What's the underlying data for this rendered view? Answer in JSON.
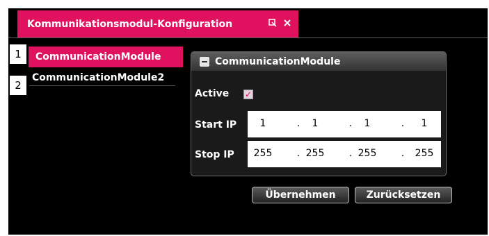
{
  "tab": {
    "title": "Kommunikationsmodul-Konfiguration"
  },
  "modules": [
    {
      "number": "1",
      "label": "CommunicationModule"
    },
    {
      "number": "2",
      "label": "CommunicationModule2"
    }
  ],
  "panel": {
    "title": "CommunicationModule",
    "active_label": "Active",
    "active_checked": true,
    "start_ip_label": "Start IP",
    "start_ip": [
      "1",
      "1",
      "1",
      "1"
    ],
    "stop_ip_label": "Stop IP",
    "stop_ip": [
      "255",
      "255",
      "255",
      "255"
    ]
  },
  "buttons": {
    "apply": "Übernehmen",
    "reset": "Zurücksetzen"
  },
  "colors": {
    "accent": "#e0115f",
    "background": "#000000"
  },
  "icons": {
    "tab_pin": "pin-icon",
    "tab_close": "close-icon",
    "panel_collapse": "collapse-icon"
  }
}
